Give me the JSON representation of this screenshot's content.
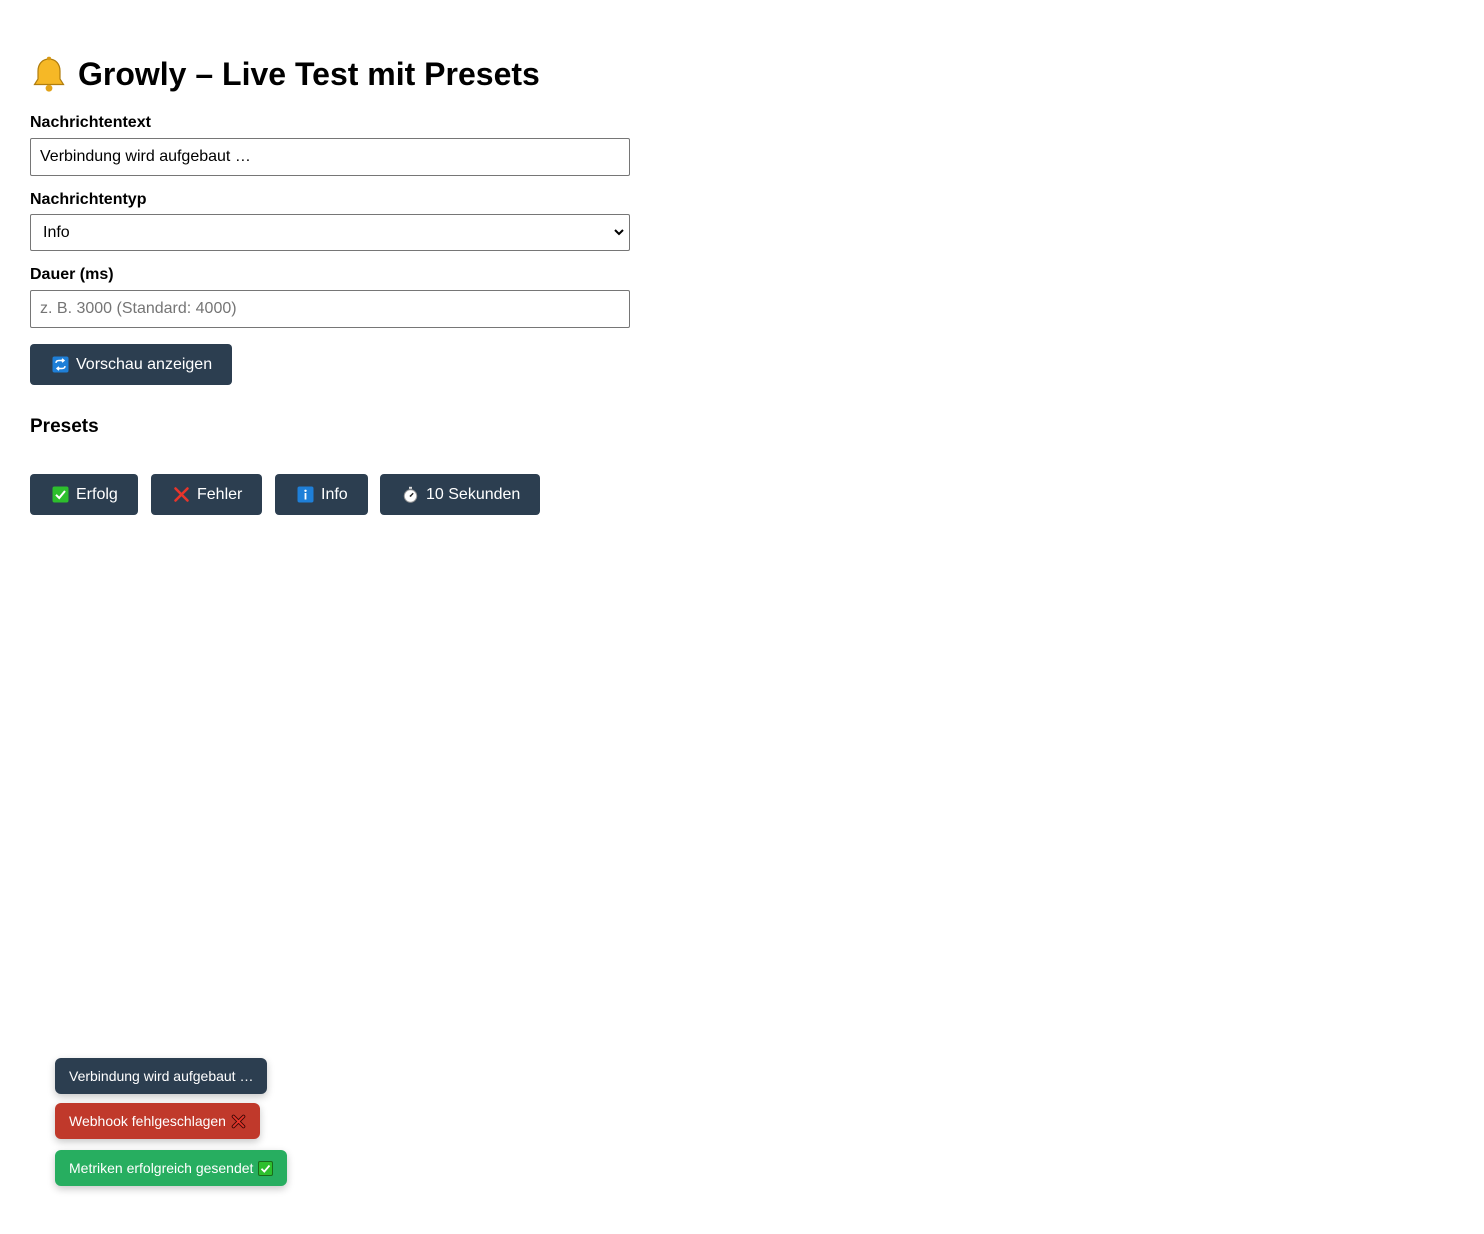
{
  "page": {
    "title": "Growly – Live Test mit Presets",
    "title_icon": "bell-icon"
  },
  "form": {
    "message_label": "Nachrichtentext",
    "message_value": "Verbindung wird aufgebaut …",
    "type_label": "Nachrichtentyp",
    "type_selected": "Info",
    "duration_label": "Dauer (ms)",
    "duration_placeholder": "z. B. 3000 (Standard: 4000)",
    "preview_button": {
      "label": "Vorschau anzeigen",
      "icon": "refresh-icon"
    }
  },
  "presets": {
    "heading": "Presets",
    "buttons": [
      {
        "label": "Erfolg",
        "icon": "check-icon"
      },
      {
        "label": "Fehler",
        "icon": "cross-icon"
      },
      {
        "label": "Info",
        "icon": "info-icon"
      },
      {
        "label": "10 Sekunden",
        "icon": "stopwatch-icon"
      }
    ]
  },
  "toasts": [
    {
      "text": "Verbindung wird aufgebaut …",
      "type": "info",
      "color": "#2c3e50"
    },
    {
      "text": "Webhook fehlgeschlagen",
      "type": "error",
      "color": "#c0392b",
      "icon": "cross-icon"
    },
    {
      "text": "Metriken erfolgreich gesendet",
      "type": "success",
      "color": "#27ae60",
      "icon": "check-icon"
    }
  ],
  "colors": {
    "button_bg": "#2c3e50",
    "error": "#c0392b",
    "success": "#27ae60",
    "check_green": "#2dbf2d",
    "info_blue": "#1e7fd8"
  }
}
